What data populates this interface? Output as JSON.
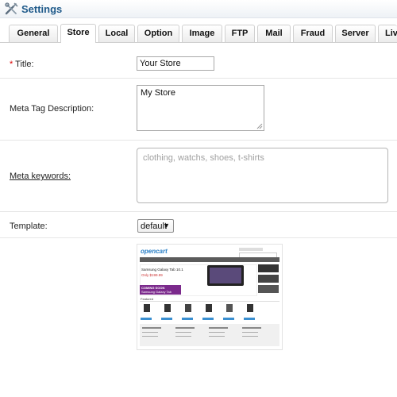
{
  "header": {
    "title": "Settings",
    "icon": "settings-tools-icon"
  },
  "tabs": [
    {
      "label": "General",
      "active": false
    },
    {
      "label": "Store",
      "active": true
    },
    {
      "label": "Local",
      "active": false
    },
    {
      "label": "Option",
      "active": false
    },
    {
      "label": "Image",
      "active": false
    },
    {
      "label": "FTP",
      "active": false
    },
    {
      "label": "Mail",
      "active": false
    },
    {
      "label": "Fraud",
      "active": false
    },
    {
      "label": "Server",
      "active": false
    },
    {
      "label": "Liv",
      "active": false
    }
  ],
  "form": {
    "title": {
      "required_mark": "*",
      "label": "Title:",
      "value": "Your Store"
    },
    "meta_description": {
      "label": "Meta Tag Description:",
      "value": "My Store"
    },
    "meta_keywords": {
      "label": "Meta keywords:",
      "placeholder": "clothing, watchs, shoes, t-shirts"
    },
    "template": {
      "label": "Template:",
      "selected": "default"
    }
  },
  "preview": {
    "logo": "opencart",
    "banner_title": "Samsung Galaxy Tab 10.1",
    "banner_price": "Only $199.99",
    "coming_soon_1": "COMING SOON",
    "coming_soon_2": "Samsung Galaxy Tab",
    "section": "Featured"
  },
  "colors": {
    "header_title": "#1f5a8a",
    "required": "#dd0000",
    "preview_banner": "#7b2a8c",
    "preview_nav": "#5b5b5b",
    "preview_button": "#3a8fd0"
  }
}
